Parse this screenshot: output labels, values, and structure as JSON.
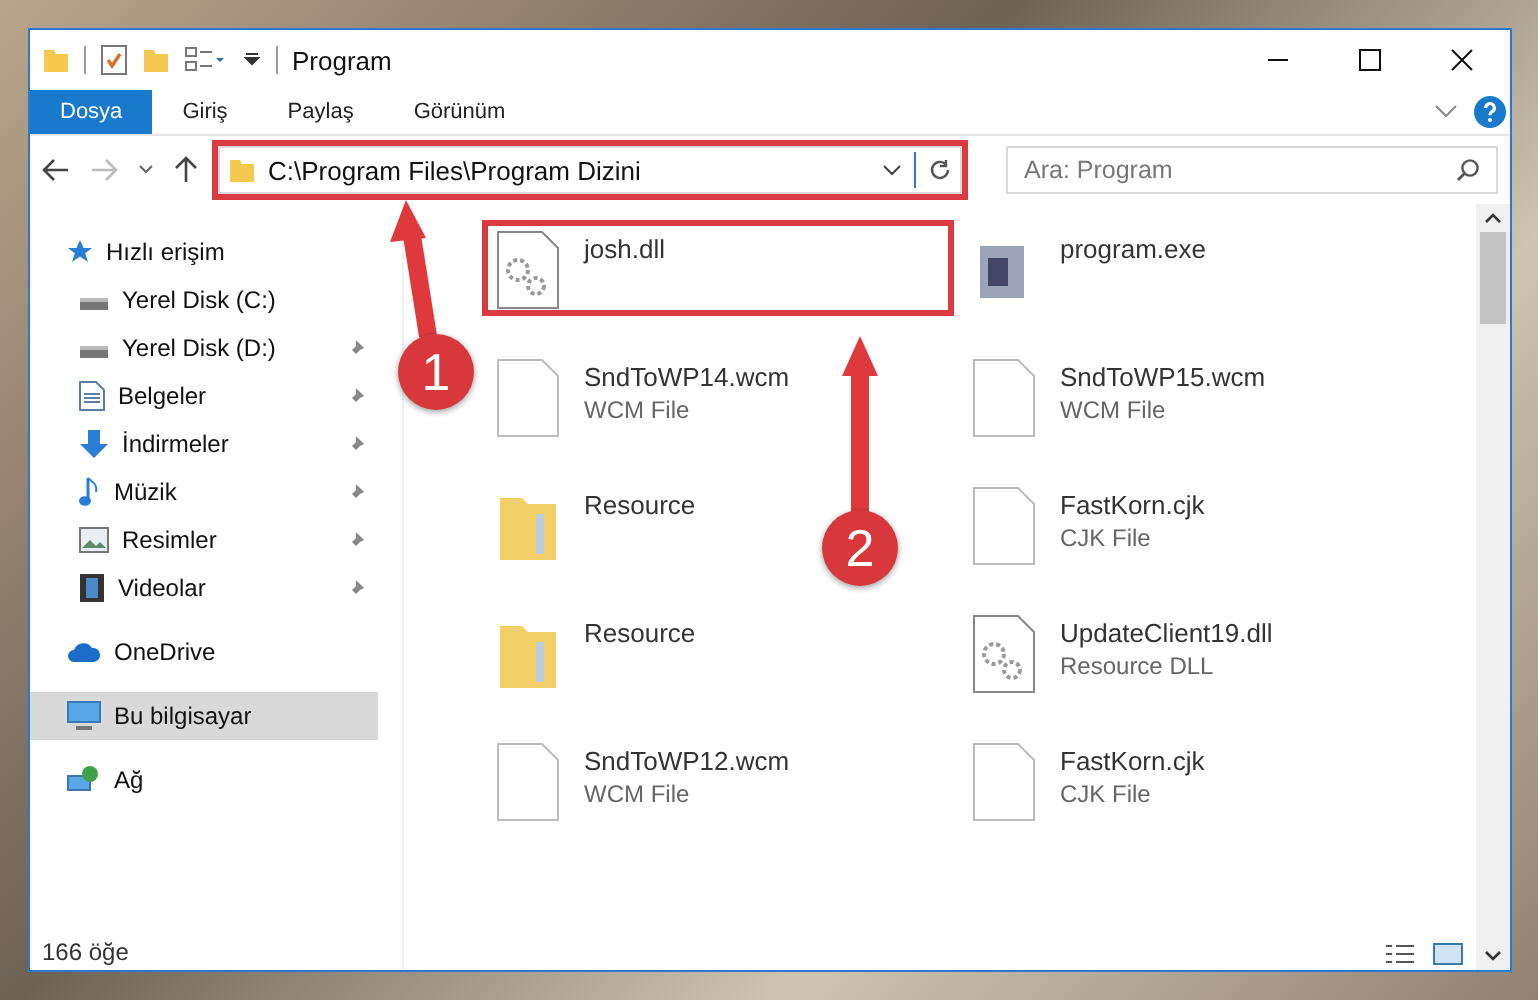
{
  "window": {
    "title": "Program"
  },
  "ribbon_tabs": [
    {
      "label": "Dosya",
      "selected": true
    },
    {
      "label": "Giriş",
      "selected": false
    },
    {
      "label": "Paylaş",
      "selected": false
    },
    {
      "label": "Görünüm",
      "selected": false
    }
  ],
  "address_bar": {
    "path": "C:\\Program Files\\Program Dizini",
    "highlighted": true
  },
  "search": {
    "placeholder": "Ara: Program"
  },
  "sidebar": {
    "items": [
      {
        "label": "Hızlı erişim",
        "kind": "star",
        "pinned": false,
        "selected": false,
        "children": [
          {
            "label": "Yerel Disk (C:)",
            "kind": "drive",
            "pinned": false,
            "selected": false
          },
          {
            "label": "Yerel Disk (D:)",
            "kind": "drive",
            "pinned": true,
            "selected": false
          },
          {
            "label": "Belgeler",
            "kind": "document",
            "pinned": true,
            "selected": false
          },
          {
            "label": "İndirmeler",
            "kind": "download",
            "pinned": true,
            "selected": false
          },
          {
            "label": "Müzik",
            "kind": "music",
            "pinned": true,
            "selected": false
          },
          {
            "label": "Resimler",
            "kind": "picture",
            "pinned": true,
            "selected": false
          },
          {
            "label": "Videolar",
            "kind": "video",
            "pinned": true,
            "selected": false
          }
        ]
      },
      {
        "label": "OneDrive",
        "kind": "cloud",
        "pinned": false,
        "selected": false
      },
      {
        "label": "Bu bilgisayar",
        "kind": "computer",
        "pinned": false,
        "selected": true
      },
      {
        "label": "Ağ",
        "kind": "network",
        "pinned": false,
        "selected": false
      }
    ]
  },
  "files": [
    {
      "name": "josh.dll",
      "kind": "dll",
      "highlighted": true
    },
    {
      "name": "program.exe",
      "kind": "exe",
      "highlighted": false
    },
    {
      "name": "SndToWP14.wcm",
      "type": "WCM File",
      "kind": "file",
      "highlighted": false
    },
    {
      "name": "SndToWP15.wcm",
      "type": "WCM File",
      "kind": "file",
      "highlighted": false
    },
    {
      "name": "Resource",
      "kind": "folder",
      "highlighted": false
    },
    {
      "name": "FastKorn.cjk",
      "type": "CJK File",
      "kind": "file",
      "highlighted": false
    },
    {
      "name": "Resource",
      "kind": "folder",
      "highlighted": false
    },
    {
      "name": "UpdateClient19.dll",
      "type": "Resource DLL",
      "kind": "dll",
      "highlighted": false
    },
    {
      "name": "SndToWP12.wcm",
      "type": "WCM File",
      "kind": "file",
      "highlighted": false
    },
    {
      "name": "FastKorn.cjk",
      "type": "CJK File",
      "kind": "file",
      "highlighted": false
    }
  ],
  "status_bar": {
    "count": "166 öğe"
  },
  "annotations": [
    {
      "label": "1"
    },
    {
      "label": "2"
    }
  ]
}
